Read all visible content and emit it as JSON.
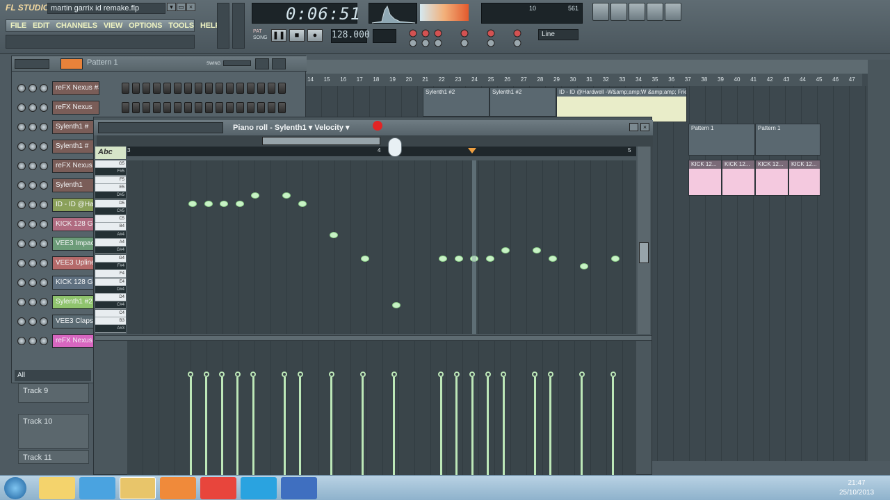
{
  "app": {
    "logo": "FL STUDIO",
    "song_title": "martin garrix id remake.flp"
  },
  "menu": [
    "FILE",
    "EDIT",
    "CHANNELS",
    "VIEW",
    "OPTIONS",
    "TOOLS",
    "HELP"
  ],
  "transport": {
    "time": "0:06:51",
    "tempo": "128.000",
    "snap": "Line",
    "cpu_value": "10",
    "ram_value": "561",
    "pat_label": "PAT",
    "song_label": "SONG"
  },
  "rack": {
    "pattern": "Pattern 1",
    "swing_label": "SWING",
    "footer": "All",
    "channels": [
      {
        "name": "reFX Nexus #3",
        "color": "#7a5d58"
      },
      {
        "name": "reFX Nexus",
        "color": "#7a5d58"
      },
      {
        "name": "Sylenth1 #",
        "color": "#7a5d58"
      },
      {
        "name": "Sylenth1 #",
        "color": "#7a5d58"
      },
      {
        "name": "reFX Nexus",
        "color": "#7a5d58"
      },
      {
        "name": "Sylenth1",
        "color": "#7a5d58"
      },
      {
        "name": "ID - ID @Ha",
        "color": "#8aa05a"
      },
      {
        "name": "KICK 128 G",
        "color": "#b06b80"
      },
      {
        "name": "VEE3 Impact",
        "color": "#6b9b78"
      },
      {
        "name": "VEE3 Upline",
        "color": "#b56a6a"
      },
      {
        "name": "KICK 128 G",
        "color": "#5f7080"
      },
      {
        "name": "Sylenth1 #2",
        "color": "#8fc46d"
      },
      {
        "name": "VEE3 Claps C",
        "color": "#5a6a72"
      },
      {
        "name": "reFX Nexus",
        "color": "#d866c0"
      }
    ]
  },
  "tracks": [
    "Track 9",
    "Track 10",
    "Track 11"
  ],
  "playlist": {
    "ruler": [
      "14",
      "15",
      "16",
      "17",
      "18",
      "19",
      "20",
      "21",
      "22",
      "23",
      "24",
      "25",
      "26",
      "27",
      "28",
      "29",
      "30",
      "31",
      "32",
      "33",
      "34",
      "35",
      "36",
      "37",
      "38",
      "39",
      "40",
      "41",
      "42",
      "43",
      "44",
      "45",
      "46",
      "47"
    ],
    "clips": [
      {
        "label": "Sylenth1 #2"
      },
      {
        "label": "Sylenth1 #2"
      },
      {
        "label": "ID - ID @Hardwell -W&amp;amp;W &amp;amp; Friendas"
      },
      {
        "label": "Pattern 1"
      },
      {
        "label": "Pattern 1"
      },
      {
        "label": "KICK 12..."
      },
      {
        "label": "KICK 12..."
      },
      {
        "label": "KICK 12..."
      },
      {
        "label": "KICK 12..."
      }
    ]
  },
  "piano_roll": {
    "title": "Piano roll - Sylenth1",
    "view": "Velocity",
    "ruler_start": "3",
    "ruler_mid": "4",
    "ruler_end": "5",
    "keys": [
      "G5",
      "F#5",
      "F5",
      "E5",
      "D#5",
      "D5",
      "C#5",
      "C5",
      "B4",
      "A#4",
      "A4",
      "G#4",
      "G4",
      "F#4",
      "F4",
      "E4",
      "D#4",
      "D4",
      "C#4",
      "C4",
      "B3",
      "A#3"
    ],
    "notes": [
      {
        "pitch": "D5",
        "step": 0
      },
      {
        "pitch": "D5",
        "step": 1
      },
      {
        "pitch": "D5",
        "step": 2
      },
      {
        "pitch": "D5",
        "step": 3
      },
      {
        "pitch": "D#5",
        "step": 4
      },
      {
        "pitch": "D#5",
        "step": 6
      },
      {
        "pitch": "D5",
        "step": 7
      },
      {
        "pitch": "A#4",
        "step": 9
      },
      {
        "pitch": "G4",
        "step": 11
      },
      {
        "pitch": "C#4",
        "step": 13
      },
      {
        "pitch": "G4",
        "step": 16
      },
      {
        "pitch": "G4",
        "step": 17
      },
      {
        "pitch": "G4",
        "step": 18
      },
      {
        "pitch": "G4",
        "step": 19
      },
      {
        "pitch": "G#4",
        "step": 20
      },
      {
        "pitch": "G#4",
        "step": 22
      },
      {
        "pitch": "G4",
        "step": 23
      },
      {
        "pitch": "F#4",
        "step": 25
      },
      {
        "pitch": "G4",
        "step": 27
      }
    ]
  },
  "taskbar": {
    "time": "21:47",
    "date": "25/10/2013"
  }
}
